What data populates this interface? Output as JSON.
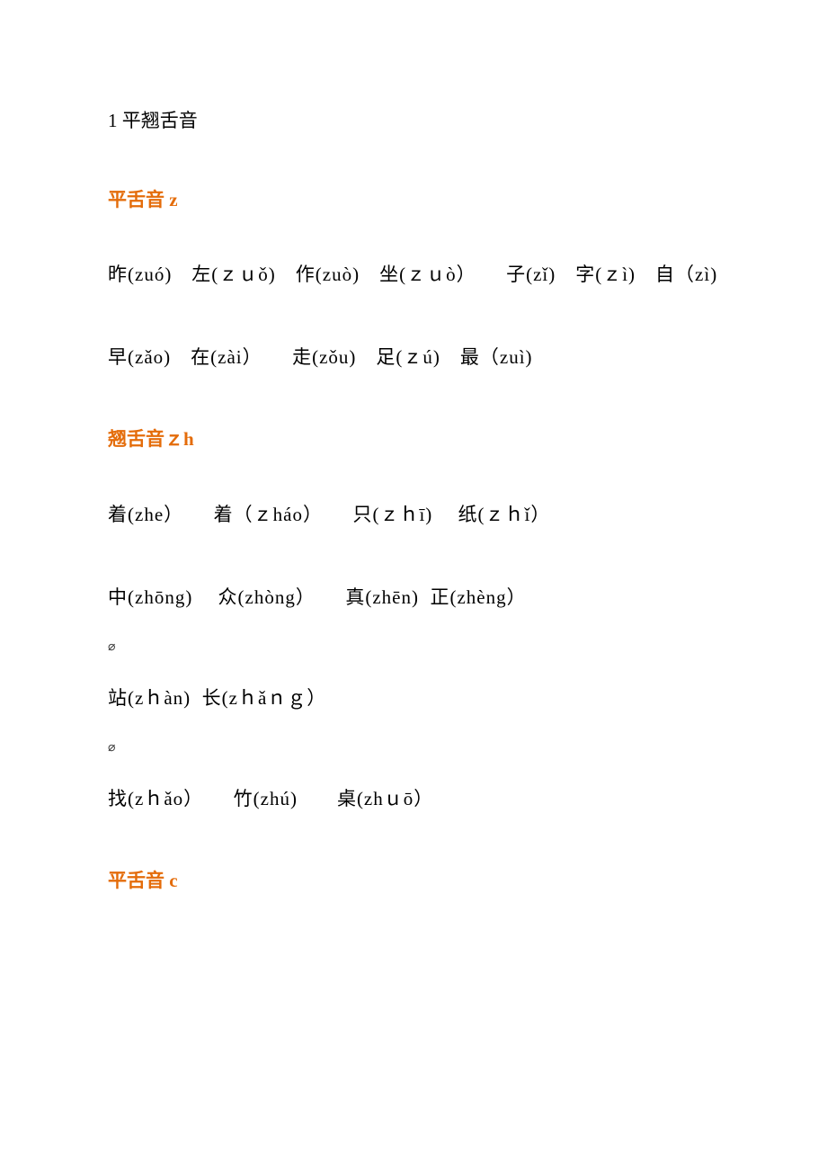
{
  "title": "1 平翘舌音",
  "sections": [
    {
      "heading": "平舌音 z",
      "lines": [
        "昨(zuó)　左(ｚｕǒ)　作(zuò)　坐(ｚｕò）　　子(zǐ)　字(ｚì)　自（zì)",
        "早(zǎo)　在(zài）　　走(zǒu)　足(ｚú)　最（zuì)"
      ]
    },
    {
      "heading": "翘舌音ｚh",
      "lines": [
        "着(zhe）　　着（ｚháo）　　只(ｚｈī)　 纸(ｚｈǐ）",
        "中(zhōng)　 众(zhòng）　　真(zhēn)  正(zhèng）",
        "_ornament_",
        "站(zｈàn)  长(zｈǎｎｇ）",
        "_ornament_",
        "找(zｈǎo）　　竹(zhú)　　桌(zhｕō）"
      ]
    },
    {
      "heading": "平舌音 c",
      "lines": []
    }
  ],
  "ornament": "⌀"
}
